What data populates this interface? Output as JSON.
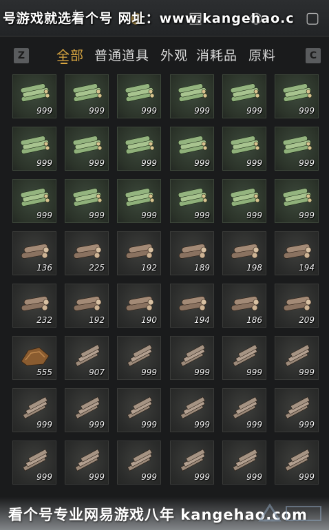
{
  "header": {
    "watermark": "号游戏就选看个号  网址：www.kangehao.c"
  },
  "tabs": {
    "left_key": "Z",
    "right_key": "C",
    "items": [
      {
        "label": "全部",
        "active": true
      },
      {
        "label": "普通道具",
        "active": false
      },
      {
        "label": "外观",
        "active": false
      },
      {
        "label": "消耗品",
        "active": false
      },
      {
        "label": "原料",
        "active": false
      }
    ]
  },
  "inventory": {
    "rows": [
      [
        {
          "icon": "bamboo-bundle-icon",
          "qty": "999"
        },
        {
          "icon": "bamboo-bundle-icon",
          "qty": "999"
        },
        {
          "icon": "bamboo-bundle-icon",
          "qty": "999"
        },
        {
          "icon": "bamboo-bundle-icon",
          "qty": "999"
        },
        {
          "icon": "bamboo-bundle-icon",
          "qty": "999"
        },
        {
          "icon": "bamboo-bundle-icon",
          "qty": "999"
        }
      ],
      [
        {
          "icon": "bamboo-bundle-icon",
          "qty": "999"
        },
        {
          "icon": "bamboo-bundle-icon",
          "qty": "999"
        },
        {
          "icon": "bamboo-bundle-icon",
          "qty": "999"
        },
        {
          "icon": "bamboo-bundle-icon",
          "qty": "999"
        },
        {
          "icon": "bamboo-bundle-icon",
          "qty": "999"
        },
        {
          "icon": "bamboo-bundle-icon",
          "qty": "999"
        }
      ],
      [
        {
          "icon": "bamboo-bundle-icon",
          "qty": "999"
        },
        {
          "icon": "bamboo-bundle-icon",
          "qty": "999"
        },
        {
          "icon": "bamboo-bundle-icon",
          "qty": "999"
        },
        {
          "icon": "bamboo-bundle-icon",
          "qty": "999"
        },
        {
          "icon": "bamboo-bundle-icon",
          "qty": "999"
        },
        {
          "icon": "bamboo-bundle-icon",
          "qty": "999"
        }
      ],
      [
        {
          "icon": "log-pile-icon",
          "qty": "136"
        },
        {
          "icon": "log-pile-icon",
          "qty": "225"
        },
        {
          "icon": "log-pile-icon",
          "qty": "192"
        },
        {
          "icon": "log-pile-icon",
          "qty": "189"
        },
        {
          "icon": "log-pile-icon",
          "qty": "198"
        },
        {
          "icon": "log-pile-icon",
          "qty": "194"
        }
      ],
      [
        {
          "icon": "log-pile-icon",
          "qty": "232"
        },
        {
          "icon": "log-pile-icon",
          "qty": "192"
        },
        {
          "icon": "log-pile-icon",
          "qty": "190"
        },
        {
          "icon": "log-pile-icon",
          "qty": "194"
        },
        {
          "icon": "log-pile-icon",
          "qty": "186"
        },
        {
          "icon": "log-pile-icon",
          "qty": "209"
        }
      ],
      [
        {
          "icon": "bark-scraps-icon",
          "qty": "555"
        },
        {
          "icon": "timber-stack-icon",
          "qty": "907"
        },
        {
          "icon": "timber-stack-icon",
          "qty": "999"
        },
        {
          "icon": "timber-stack-icon",
          "qty": "999"
        },
        {
          "icon": "timber-stack-icon",
          "qty": "999"
        },
        {
          "icon": "timber-stack-icon",
          "qty": "999"
        }
      ],
      [
        {
          "icon": "timber-stack-icon",
          "qty": "999"
        },
        {
          "icon": "timber-stack-icon",
          "qty": "999"
        },
        {
          "icon": "timber-stack-icon",
          "qty": "999"
        },
        {
          "icon": "timber-stack-icon",
          "qty": "999"
        },
        {
          "icon": "timber-stack-icon",
          "qty": "999"
        },
        {
          "icon": "timber-stack-icon",
          "qty": "999"
        }
      ],
      [
        {
          "icon": "timber-stack-icon",
          "qty": "999"
        },
        {
          "icon": "timber-stack-icon",
          "qty": "999"
        },
        {
          "icon": "timber-stack-icon",
          "qty": "999"
        },
        {
          "icon": "timber-stack-icon",
          "qty": "999"
        },
        {
          "icon": "timber-stack-icon",
          "qty": "999"
        },
        {
          "icon": "timber-stack-icon",
          "qty": "999"
        }
      ]
    ]
  },
  "footer": {
    "watermark": "看个号专业网易游戏八年 kangehao.com"
  },
  "colors": {
    "accent": "#d9a640",
    "background": "#1a1b1c"
  }
}
